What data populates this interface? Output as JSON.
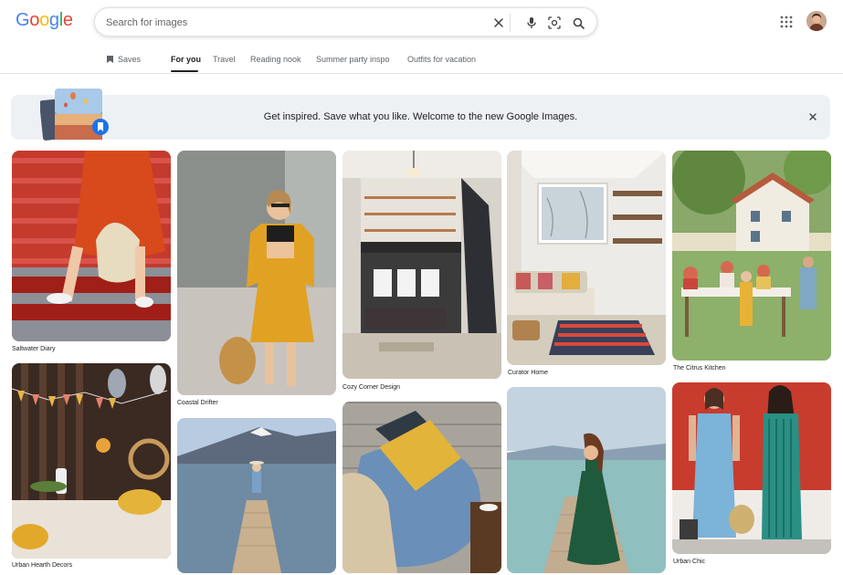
{
  "header": {
    "logo_letters": [
      "G",
      "o",
      "o",
      "g",
      "l",
      "e"
    ],
    "search": {
      "placeholder": "Search for images",
      "value": ""
    }
  },
  "tabs": [
    {
      "label": "Saves",
      "active": false
    },
    {
      "label": "For you",
      "active": true
    },
    {
      "label": "Travel",
      "active": false
    },
    {
      "label": "Reading nook",
      "active": false
    },
    {
      "label": "Summer party inspo",
      "active": false
    },
    {
      "label": "Outfits for vacation",
      "active": false
    }
  ],
  "banner": {
    "text": "Get inspired. Save what you like. Welcome to the new Google Images."
  },
  "tiles": [
    {
      "caption": "Saltwater Diary"
    },
    {
      "caption": "Coastal Drifter"
    },
    {
      "caption": "Cozy Corner Design"
    },
    {
      "caption": "Curator Home"
    },
    {
      "caption": "The Citrus Kitchen"
    },
    {
      "caption": "Urban Hearth Decors"
    },
    {
      "caption": ""
    },
    {
      "caption": ""
    },
    {
      "caption": ""
    },
    {
      "caption": "Urban Chic"
    }
  ],
  "colors": {
    "google_blue": "#4285F4",
    "google_red": "#EA4335",
    "google_yellow": "#FBBC05",
    "google_green": "#34A853",
    "banner_bg": "#eef1f4"
  },
  "icons": [
    "clear-icon",
    "microphone-icon",
    "camera-lens-icon",
    "search-icon",
    "apps-grid-icon",
    "bookmark-icon",
    "close-icon"
  ]
}
